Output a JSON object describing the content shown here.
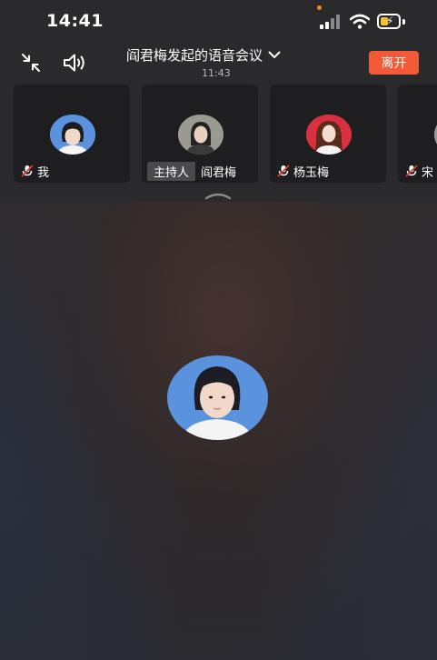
{
  "status_bar": {
    "time": "14:41"
  },
  "header": {
    "title": "阎君梅发起的语音会议",
    "elapsed": "11:43",
    "leave_label": "离开"
  },
  "icons": {
    "collapse": "collapse-arrows-icon",
    "speaker": "speaker-icon",
    "dropdown": "chevron-down-icon",
    "mute": "mic-muted-icon"
  },
  "participants": [
    {
      "name": "我",
      "muted": true,
      "host": false,
      "bg": "#5a8fd8"
    },
    {
      "name": "阎君梅",
      "muted": false,
      "host": true,
      "host_label": "主持人",
      "bg": "#8a8a80"
    },
    {
      "name": "杨玉梅",
      "muted": true,
      "host": false,
      "bg": "#d83040"
    },
    {
      "name": "宋",
      "muted": true,
      "host": false,
      "bg": "#9a9a9a"
    }
  ],
  "colors": {
    "accent": "#f35a38",
    "mute_red": "#e23a2e"
  }
}
